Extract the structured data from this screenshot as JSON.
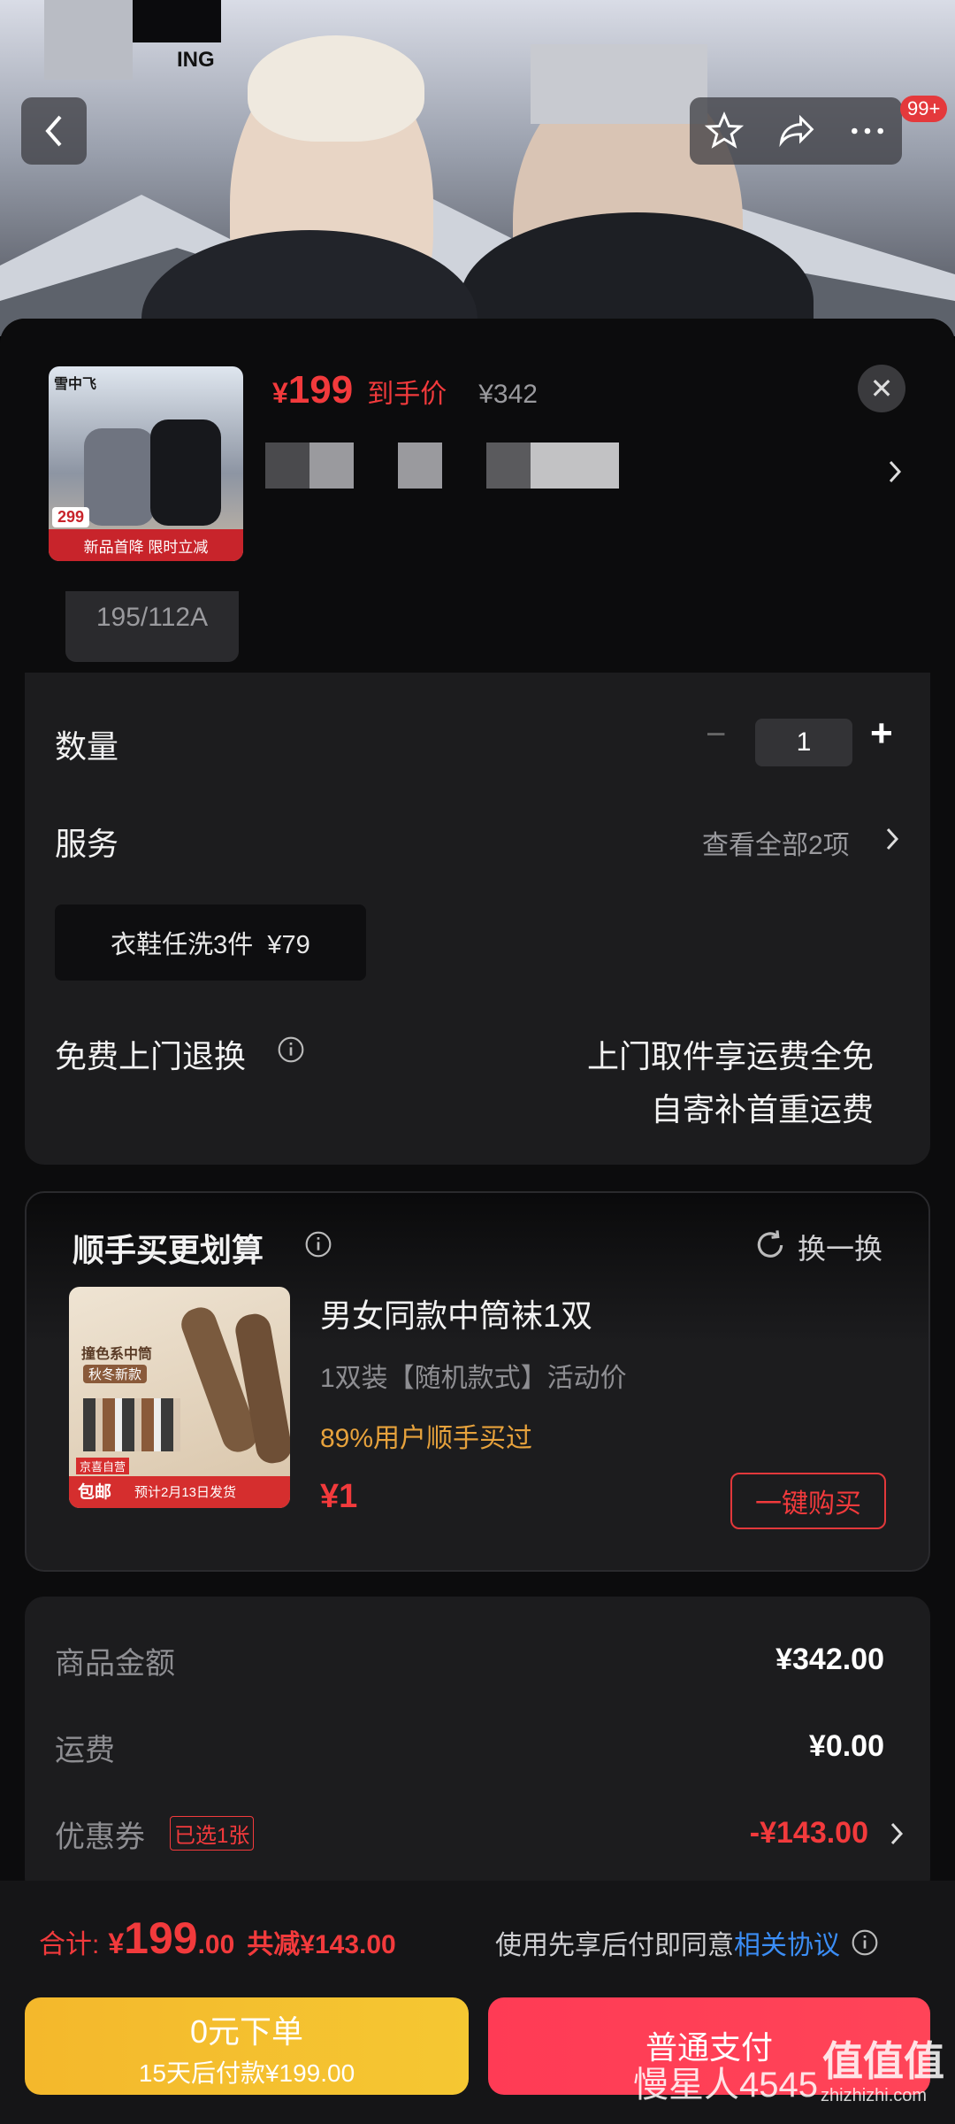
{
  "header": {
    "brand_text": "ING",
    "notif_badge": "99+",
    "icons": [
      "back-icon",
      "star-icon",
      "share-icon",
      "more-icon"
    ]
  },
  "product": {
    "price_symbol": "¥",
    "price": "199",
    "price_label": "到手价",
    "original_price": "¥342",
    "thumb_price": "299",
    "thumb_banner": "新品首降 限时立减",
    "thumb_brand": "雪中飞"
  },
  "size_option": {
    "label": "195/112A"
  },
  "quantity": {
    "label": "数量",
    "value": "1",
    "minus": "−",
    "plus": "+"
  },
  "service": {
    "label": "服务",
    "view_all": "查看全部2项",
    "chip": "衣鞋任洗3件  ¥79"
  },
  "return": {
    "label": "免费上门退换",
    "line1": "上门取件享运费全免",
    "line2": "自寄补首重运费"
  },
  "addon": {
    "title": "顺手买更划算",
    "swap": "换一换",
    "item_title": "男女同款中筒袜1双",
    "item_desc": "1双装【随机款式】活动价",
    "item_stat": "89%用户顺手买过",
    "item_price": "¥1",
    "buy_button": "一键购买",
    "thumb_top": "撞色系中筒",
    "thumb_sub": "秋冬新款",
    "thumb_badge": "包邮",
    "thumb_ship": "预计2月13日发货",
    "thumb_store": "京喜自营"
  },
  "summary": {
    "goods_label": "商品金额",
    "goods_value": "¥342.00",
    "ship_label": "运费",
    "ship_value": "¥0.00",
    "coupon_label": "优惠券",
    "coupon_tag": "已选1张",
    "coupon_value": "-¥143.00"
  },
  "footer": {
    "total_label": "合计:",
    "total_symbol": "¥",
    "total_int": "199",
    "total_dec": ".00",
    "saved": "共减¥143.00",
    "agree_text": "使用先享后付即同意",
    "agree_link": "相关协议",
    "btn_a_title": "0元下单",
    "btn_a_sub": "15天后付款¥199.00",
    "btn_b_title": "普通支付",
    "watermark": "慢星人4545",
    "watermark2": "值值值",
    "watermark3": "zhizhizhi.com"
  },
  "colors": {
    "accent_red": "#f23a3c",
    "orange": "#e7a23c",
    "link_blue": "#3b8df5"
  }
}
